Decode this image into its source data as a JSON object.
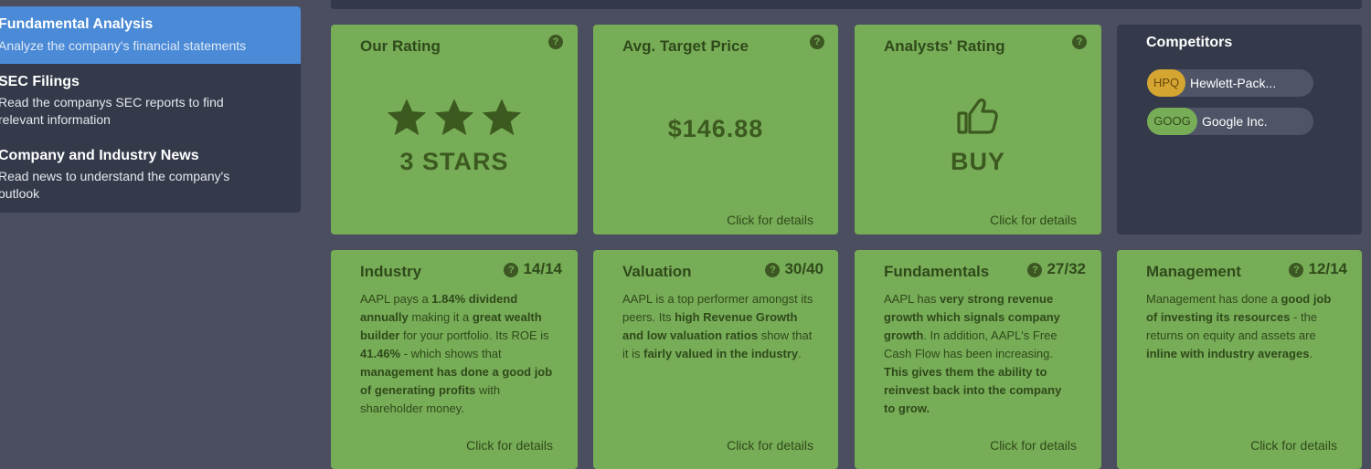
{
  "sidebar": {
    "items": [
      {
        "title": "Fundamental Analysis",
        "desc": "Analyze the company's financial statements"
      },
      {
        "title": "SEC Filings",
        "desc": "Read the companys SEC reports to find relevant information"
      },
      {
        "title": "Company and Industry News",
        "desc": "Read news to understand the company's outlook"
      }
    ]
  },
  "help_glyph": "?",
  "details_label": "Click for details",
  "rating": {
    "title": "Our Rating",
    "stars": 3,
    "stars_max": 3,
    "label": "3 STARS"
  },
  "target": {
    "title": "Avg. Target Price",
    "value": "$146.88"
  },
  "analysts": {
    "title": "Analysts' Rating",
    "value": "BUY"
  },
  "competitors": {
    "title": "Competitors",
    "items": [
      {
        "ticker": "HPQ",
        "name": "Hewlett-Pack...",
        "color": "#d4a531"
      },
      {
        "ticker": "GOOG",
        "name": "Google Inc.",
        "color": "#78ad58"
      }
    ]
  },
  "scores": {
    "industry": {
      "title": "Industry",
      "score": "14/14"
    },
    "valuation": {
      "title": "Valuation",
      "score": "30/40"
    },
    "fundamentals": {
      "title": "Fundamentals",
      "score": "27/32"
    },
    "management": {
      "title": "Management",
      "score": "12/14"
    }
  },
  "texts": {
    "industry": [
      {
        "t": "AAPL pays a ",
        "b": false
      },
      {
        "t": "1.84% dividend annually",
        "b": true
      },
      {
        "t": " making it a ",
        "b": false
      },
      {
        "t": "great wealth builder",
        "b": true
      },
      {
        "t": " for your portfolio. Its ROE is ",
        "b": false
      },
      {
        "t": "41.46%",
        "b": true
      },
      {
        "t": " - which shows that ",
        "b": false
      },
      {
        "t": "management has done a good job of generating profits",
        "b": true
      },
      {
        "t": " with shareholder money.",
        "b": false
      }
    ],
    "valuation": [
      {
        "t": "AAPL is a top performer amongst its peers. Its ",
        "b": false
      },
      {
        "t": "high Revenue Growth and low valuation ratios",
        "b": true
      },
      {
        "t": " show that it is ",
        "b": false
      },
      {
        "t": "fairly valued in the industry",
        "b": true
      },
      {
        "t": ".",
        "b": false
      }
    ],
    "fundamentals": [
      {
        "t": "AAPL has ",
        "b": false
      },
      {
        "t": "very strong revenue growth which signals company growth",
        "b": true
      },
      {
        "t": ". In addition, AAPL's Free Cash Flow has been increasing. ",
        "b": false
      },
      {
        "t": "This gives them the ability to reinvest back into the company to grow.",
        "b": true
      }
    ],
    "management": [
      {
        "t": "Management has done a ",
        "b": false
      },
      {
        "t": "good job of investing its resources",
        "b": true
      },
      {
        "t": " - the returns on equity and assets are ",
        "b": false
      },
      {
        "t": "inline with industry averages",
        "b": true
      },
      {
        "t": ".",
        "b": false
      }
    ]
  }
}
